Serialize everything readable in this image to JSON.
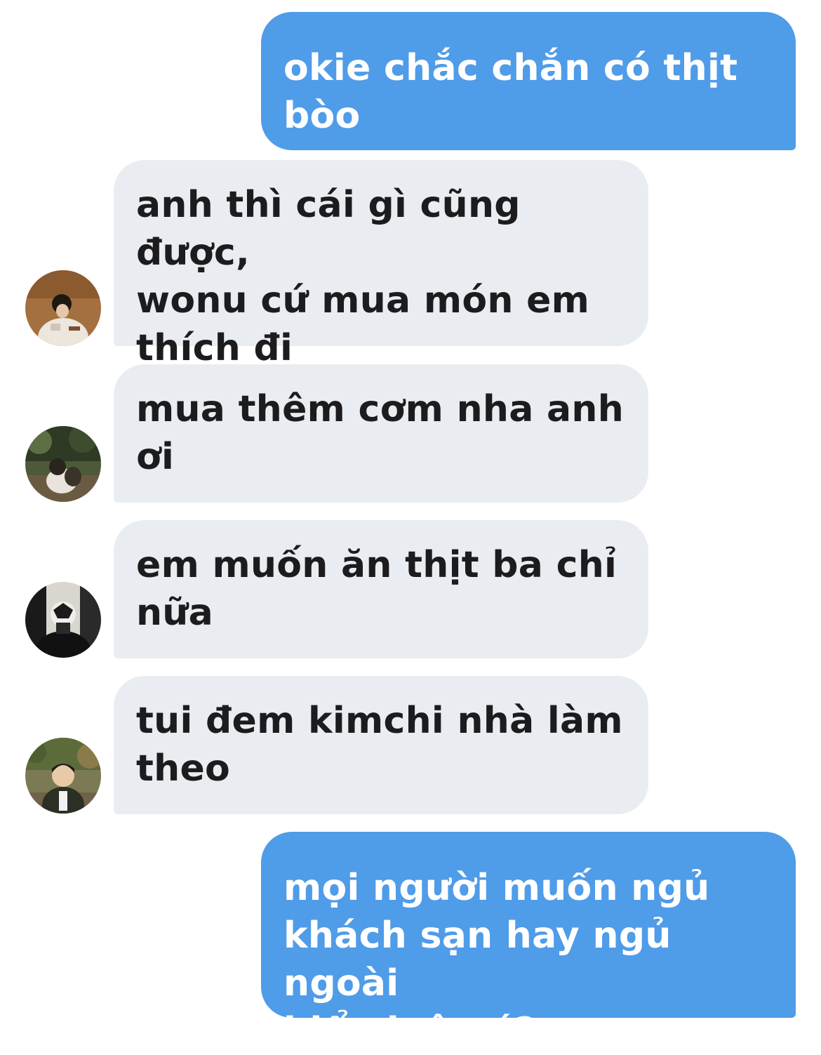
{
  "messages": [
    {
      "id": "m1",
      "direction": "outgoing",
      "text": "okie chắc chắn có thịt\nbòo"
    },
    {
      "id": "m2",
      "direction": "incoming",
      "text": "anh thì cái gì cũng được,\nwonu cứ mua món em\nthích đi",
      "avatar": "avatar-sender-1"
    },
    {
      "id": "m3",
      "direction": "incoming",
      "text": "mua thêm cơm nha anh\nơi",
      "avatar": "avatar-sender-2"
    },
    {
      "id": "m4",
      "direction": "incoming",
      "text": "em muốn ăn thịt ba chỉ\nnữa",
      "avatar": "avatar-sender-3"
    },
    {
      "id": "m5",
      "direction": "incoming",
      "text": "tui đem kimchi nhà làm\ntheo",
      "avatar": "avatar-sender-4"
    },
    {
      "id": "m6",
      "direction": "outgoing",
      "text": "mọi người muốn ngủ\nkhách sạn hay ngủ ngoài\nbiển luôn á?"
    }
  ],
  "colors": {
    "outgoing_bubble": "#4f9ce9",
    "incoming_bubble": "#e9ecf0",
    "outgoing_text": "#ffffff",
    "incoming_text": "#1c1c1e",
    "background": "#ffffff"
  }
}
